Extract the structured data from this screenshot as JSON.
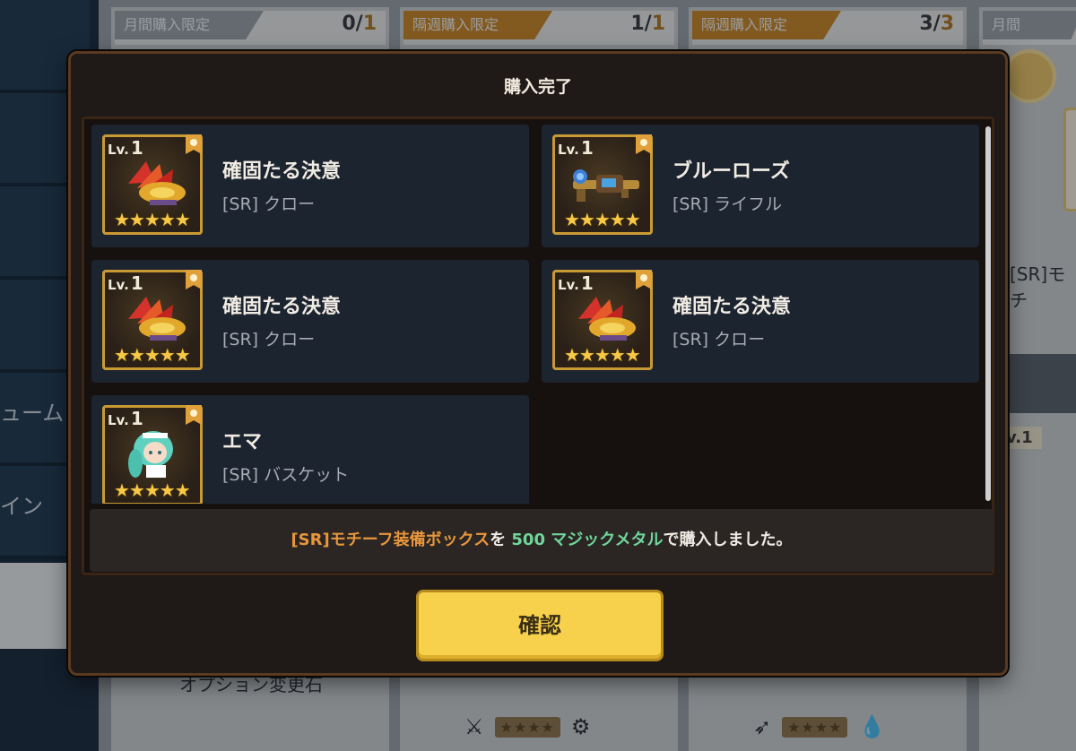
{
  "background": {
    "sidebar": [
      {
        "label": ""
      },
      {
        "label": ""
      },
      {
        "label": ""
      },
      {
        "label": ""
      },
      {
        "label": "ューム"
      },
      {
        "label": "イン"
      }
    ],
    "cards": [
      {
        "tag": "月間購入限定",
        "count_current": "0",
        "count_max": "1",
        "tag_color": "#9aa3ad"
      },
      {
        "tag": "隔週購入限定",
        "count_current": "1",
        "count_max": "1",
        "tag_color": "#c8892f"
      },
      {
        "tag": "隔週購入限定",
        "count_current": "3",
        "count_max": "3",
        "tag_color": "#c8892f"
      },
      {
        "tag": "月間購入限定",
        "count_current": "",
        "count_max": "",
        "tag_color": "#9aa3ad"
      }
    ],
    "behind_text": "オプション変更石",
    "right_text": "[SR]モチ",
    "right_lv": "v.1",
    "footer_stars": "★★★★"
  },
  "modal": {
    "title": "購入完了",
    "items": [
      {
        "level_prefix": "Lv.",
        "level": "1",
        "name": "確固たる決意",
        "type": "[SR] クロー",
        "stars": "★★★★★",
        "icon": "claw-weapon-icon"
      },
      {
        "level_prefix": "Lv.",
        "level": "1",
        "name": "ブルーローズ",
        "type": "[SR] ライフル",
        "stars": "★★★★★",
        "icon": "rifle-weapon-icon"
      },
      {
        "level_prefix": "Lv.",
        "level": "1",
        "name": "確固たる決意",
        "type": "[SR] クロー",
        "stars": "★★★★★",
        "icon": "claw-weapon-icon"
      },
      {
        "level_prefix": "Lv.",
        "level": "1",
        "name": "確固たる決意",
        "type": "[SR] クロー",
        "stars": "★★★★★",
        "icon": "claw-weapon-icon"
      },
      {
        "level_prefix": "Lv.",
        "level": "1",
        "name": "エマ",
        "type": "[SR] バスケット",
        "stars": "★★★★★",
        "icon": "character-emma-icon"
      }
    ],
    "message": {
      "item": "[SR]モチーフ装備ボックス",
      "part1": "を ",
      "amount": "500 マジックメタル",
      "part2": "で購入しました。"
    },
    "confirm_label": "確認"
  },
  "colors": {
    "accent": "#f7d14b",
    "item_highlight": "#e8963c",
    "currency": "#6fd69a",
    "frame": "#c99a34"
  }
}
